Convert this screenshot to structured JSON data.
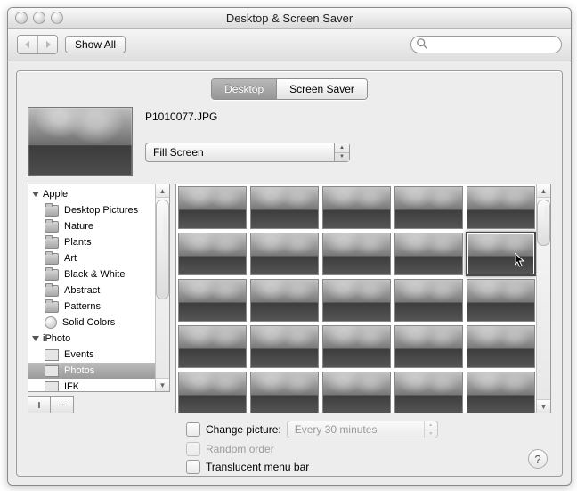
{
  "window": {
    "title": "Desktop & Screen Saver"
  },
  "toolbar": {
    "show_all": "Show All"
  },
  "search": {
    "placeholder": ""
  },
  "tabs": {
    "desktop": "Desktop",
    "screensaver": "Screen Saver",
    "selected": "Desktop"
  },
  "current": {
    "filename": "P1010077.JPG"
  },
  "fit_popup": {
    "value": "Fill Screen"
  },
  "source_list": {
    "groups": [
      {
        "label": "Apple",
        "items": [
          {
            "label": "Desktop Pictures",
            "icon": "folder"
          },
          {
            "label": "Nature",
            "icon": "folder"
          },
          {
            "label": "Plants",
            "icon": "folder"
          },
          {
            "label": "Art",
            "icon": "folder"
          },
          {
            "label": "Black & White",
            "icon": "folder"
          },
          {
            "label": "Abstract",
            "icon": "folder"
          },
          {
            "label": "Patterns",
            "icon": "folder"
          },
          {
            "label": "Solid Colors",
            "icon": "circle"
          }
        ]
      },
      {
        "label": "iPhoto",
        "items": [
          {
            "label": "Events",
            "icon": "rect"
          },
          {
            "label": "Photos",
            "icon": "rect",
            "selected": true
          },
          {
            "label": "IFK",
            "icon": "rect"
          }
        ]
      }
    ]
  },
  "options": {
    "change_picture_label": "Change picture:",
    "interval_value": "Every 30 minutes",
    "random_order_label": "Random order",
    "translucent_label": "Translucent menu bar"
  }
}
